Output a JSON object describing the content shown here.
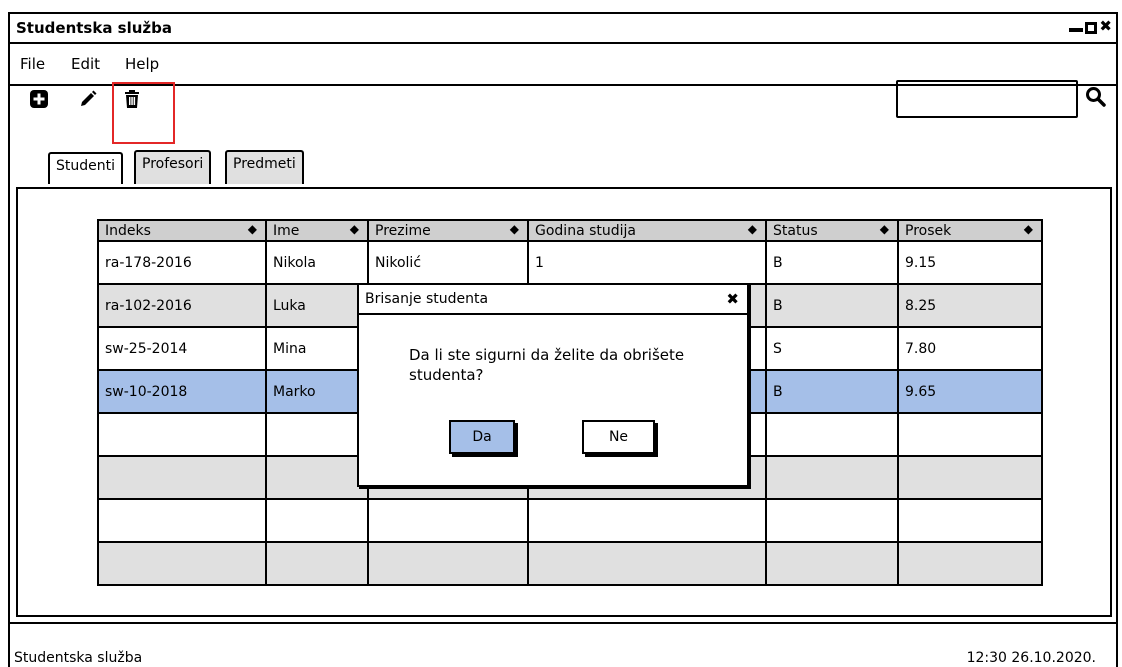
{
  "window": {
    "title": "Studentska služba"
  },
  "menu": {
    "items": [
      "File",
      "Edit",
      "Help"
    ]
  },
  "toolbar": {
    "icons": [
      "plus-square-icon",
      "pencil-icon",
      "trash-icon"
    ]
  },
  "tabs": [
    {
      "label": "Studenti",
      "active": true
    },
    {
      "label": "Profesori",
      "active": false
    },
    {
      "label": "Predmeti",
      "active": false
    }
  ],
  "table": {
    "columns": [
      "Indeks",
      "Ime",
      "Prezime",
      "Godina studija",
      "Status",
      "Prosek"
    ],
    "rows": [
      [
        "ra-178-2016",
        "Nikola",
        "Nikolić",
        "1",
        "B",
        "9.15"
      ],
      [
        "ra-102-2016",
        "Luka",
        "",
        "",
        "B",
        "8.25"
      ],
      [
        "sw-25-2014",
        "Mina",
        "",
        "",
        "S",
        "7.80"
      ],
      [
        "sw-10-2018",
        "Marko",
        "",
        "",
        "B",
        "9.65"
      ]
    ],
    "selected_row": 3
  },
  "dialog": {
    "title": "Brisanje studenta",
    "message": "Da li ste sigurni da želite da obrišete studenta?",
    "buttons": {
      "yes": "Da",
      "no": "Ne"
    }
  },
  "statusbar": {
    "left": "Studentska služba",
    "right": "12:30 26.10.2020."
  },
  "colors": {
    "selected": "#a5bfe8",
    "alt_row": "#e0e0e0",
    "highlight": "#e32727"
  }
}
